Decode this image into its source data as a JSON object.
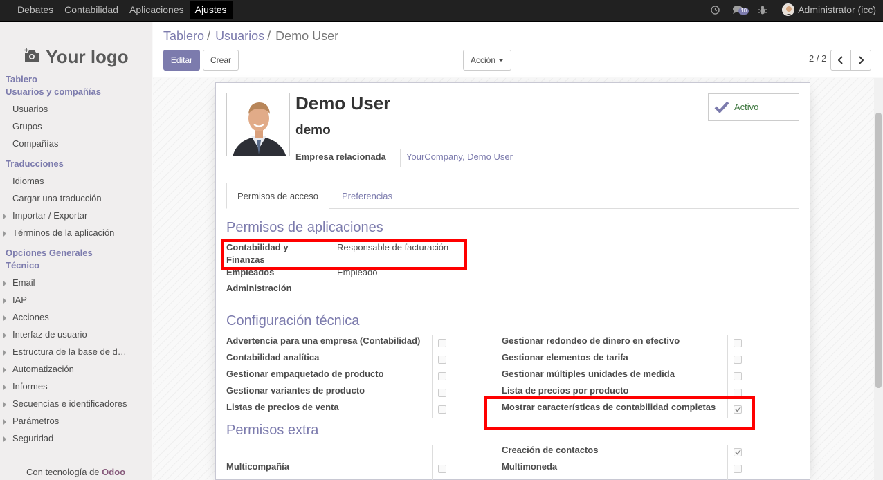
{
  "topbar": {
    "menu": [
      "Debates",
      "Contabilidad",
      "Aplicaciones",
      "Ajustes"
    ],
    "messages_count": "10",
    "user": "Administrator (icc)"
  },
  "sidebar": {
    "logo_text": "Your logo",
    "head_tablero": "Tablero",
    "head_usuarios": "Usuarios y compañías",
    "usuarios": "Usuarios",
    "grupos": "Grupos",
    "companias": "Compañías",
    "head_traducciones": "Traducciones",
    "idiomas": "Idiomas",
    "cargar": "Cargar una traducción",
    "importar": "Importar / Exportar",
    "terminos": "Términos de la aplicación",
    "head_opciones": "Opciones Generales",
    "head_tecnico": "Técnico",
    "email": "Email",
    "iap": "IAP",
    "acciones": "Acciones",
    "interfaz": "Interfaz de usuario",
    "estructura": "Estructura de la base de d…",
    "automatizacion": "Automatización",
    "informes": "Informes",
    "secuencias": "Secuencias e identificadores",
    "parametros": "Parámetros",
    "seguridad": "Seguridad",
    "powered_prefix": "Con tecnología de",
    "powered_brand": "Odoo"
  },
  "breadcrumb": {
    "b1": "Tablero",
    "b2": "Usuarios",
    "current": "Demo User"
  },
  "buttons": {
    "edit": "Editar",
    "create": "Crear",
    "action": "Acción"
  },
  "pager": {
    "value": "2 / 2"
  },
  "user": {
    "name": "Demo User",
    "login": "demo",
    "related_label": "Empresa relacionada",
    "related_value": "YourCompany, Demo User",
    "active_label": "Activo"
  },
  "tabs": {
    "access": "Permisos de acceso",
    "prefs": "Preferencias"
  },
  "perm_apps": {
    "title": "Permisos de aplicaciones",
    "r1_label_a": "Contabilidad y",
    "r1_label_b": "Finanzas",
    "r1_value": "Responsable de facturación",
    "r2_label": "Empleados",
    "r2_value": "Empleado",
    "r3_label": "Administración"
  },
  "tech": {
    "title": "Configuración técnica",
    "left": [
      "Advertencia para una empresa (Contabilidad)",
      "Contabilidad analítica",
      "Gestionar empaquetado de producto",
      "Gestionar variantes de producto",
      "Listas de precios de venta"
    ],
    "right": [
      "Gestionar redondeo de dinero en efectivo",
      "Gestionar elementos de tarifa",
      "Gestionar múltiples unidades de medida",
      "Lista de precios por producto",
      "Mostrar características de contabilidad completas"
    ]
  },
  "extra": {
    "title": "Permisos extra",
    "r1_right": "Creación de contactos",
    "r2_left": "Multicompañía",
    "r2_right": "Multimoneda"
  },
  "colors": {
    "accent": "#7c7bad",
    "highlight": "#ff0000"
  }
}
